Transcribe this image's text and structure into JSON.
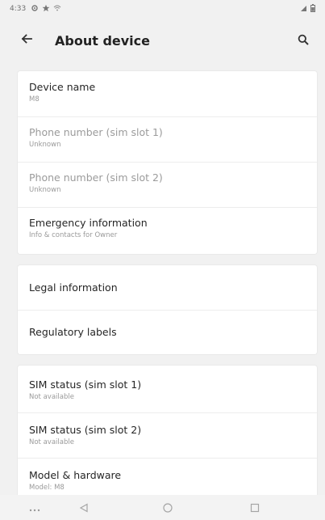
{
  "status_bar": {
    "time": "4:33",
    "icons_left": [
      "settings-icon",
      "star-icon",
      "wifi-icon"
    ],
    "icons_right": [
      "signal-icon",
      "battery-icon"
    ]
  },
  "app_bar": {
    "title": "About device"
  },
  "section_device": [
    {
      "title": "Device name",
      "subtitle": "M8",
      "enabled": true
    },
    {
      "title": "Phone number (sim slot 1)",
      "subtitle": "Unknown",
      "enabled": false
    },
    {
      "title": "Phone number (sim slot 2)",
      "subtitle": "Unknown",
      "enabled": false
    },
    {
      "title": "Emergency information",
      "subtitle": "Info & contacts for Owner",
      "enabled": true
    }
  ],
  "section_legal": [
    {
      "title": "Legal information"
    },
    {
      "title": "Regulatory labels"
    }
  ],
  "section_status": [
    {
      "title": "SIM status (sim slot 1)",
      "subtitle": "Not available"
    },
    {
      "title": "SIM status (sim slot 2)",
      "subtitle": "Not available"
    },
    {
      "title": "Model & hardware",
      "subtitle": "Model: M8"
    }
  ],
  "nav_bar": {
    "buttons": [
      "menu-dots",
      "back",
      "home",
      "recents"
    ]
  },
  "colors": {
    "background": "#f1f1f1",
    "card": "#ffffff",
    "text_primary": "#262626",
    "text_secondary": "#9a9a9a",
    "text_disabled": "#9b9b9b"
  }
}
